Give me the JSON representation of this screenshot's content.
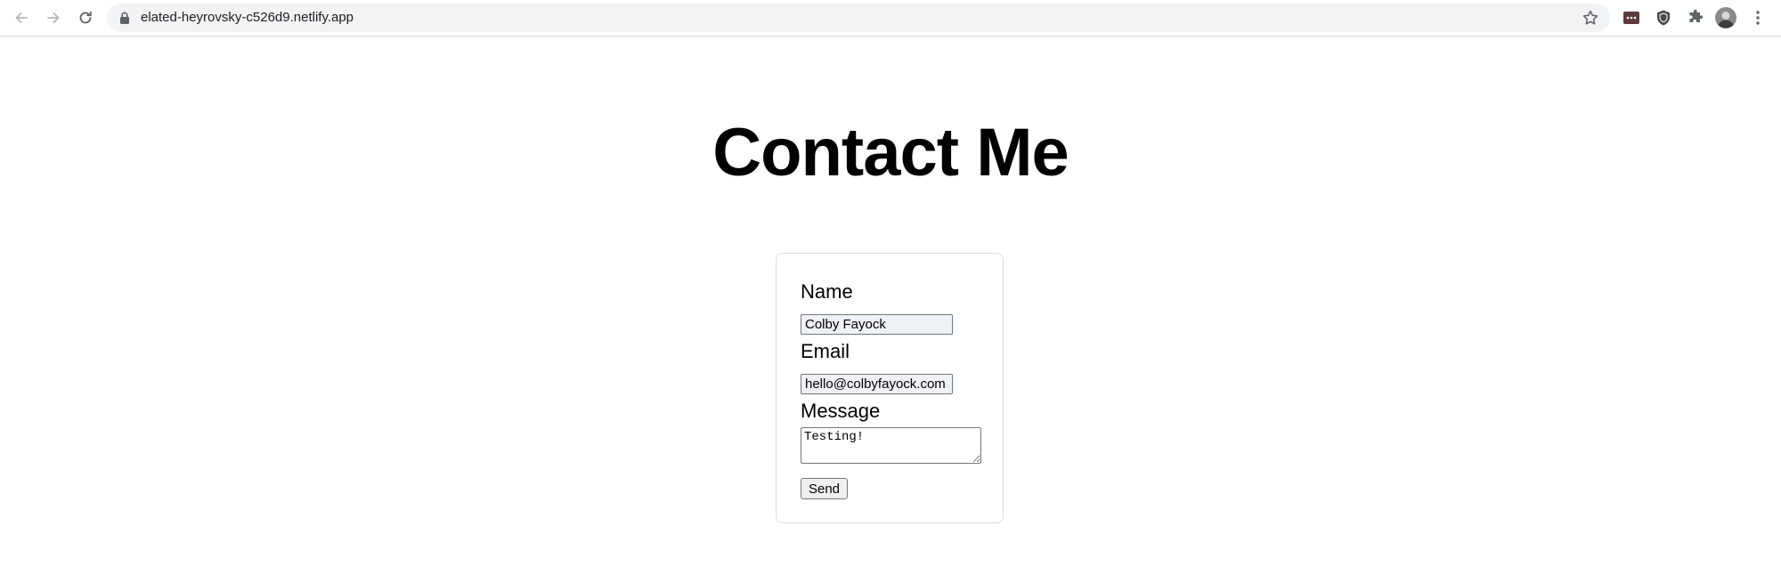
{
  "browser": {
    "url": "elated-heyrovsky-c526d9.netlify.app",
    "icons": {
      "back": "back-arrow-icon",
      "forward": "forward-arrow-icon",
      "reload": "reload-icon",
      "lock": "lock-icon",
      "bookmark": "star-icon",
      "extensions": [
        "password-manager-icon",
        "shield-extension-icon",
        "puzzle-icon"
      ],
      "profile": "avatar",
      "menu": "kebab-menu-icon"
    }
  },
  "page": {
    "title": "Contact Me"
  },
  "form": {
    "name_label": "Name",
    "name_value": "Colby Fayock",
    "email_label": "Email",
    "email_value": "hello@colbyfayock.com",
    "message_label": "Message",
    "message_value": "Testing!",
    "submit_label": "Send"
  }
}
